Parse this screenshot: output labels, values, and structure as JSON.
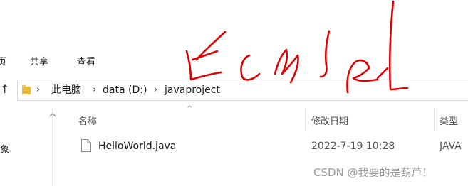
{
  "ribbon": {
    "tabs": [
      {
        "label": "页"
      },
      {
        "label": "共享"
      },
      {
        "label": "查看"
      }
    ]
  },
  "address": {
    "crumbs": [
      "此电脑",
      "data (D:)",
      "javaproject"
    ]
  },
  "columns": {
    "name": "名称",
    "date": "修改日期",
    "type": "类型"
  },
  "nav": {
    "partial_label": "象"
  },
  "files": [
    {
      "name": "HelloWorld.java",
      "date": "2022-7-19 10:28",
      "type": "JAVA"
    }
  ],
  "annotation": {
    "handwriting_color": "#e00000"
  },
  "watermark": "CSDN @我要的是葫芦！"
}
